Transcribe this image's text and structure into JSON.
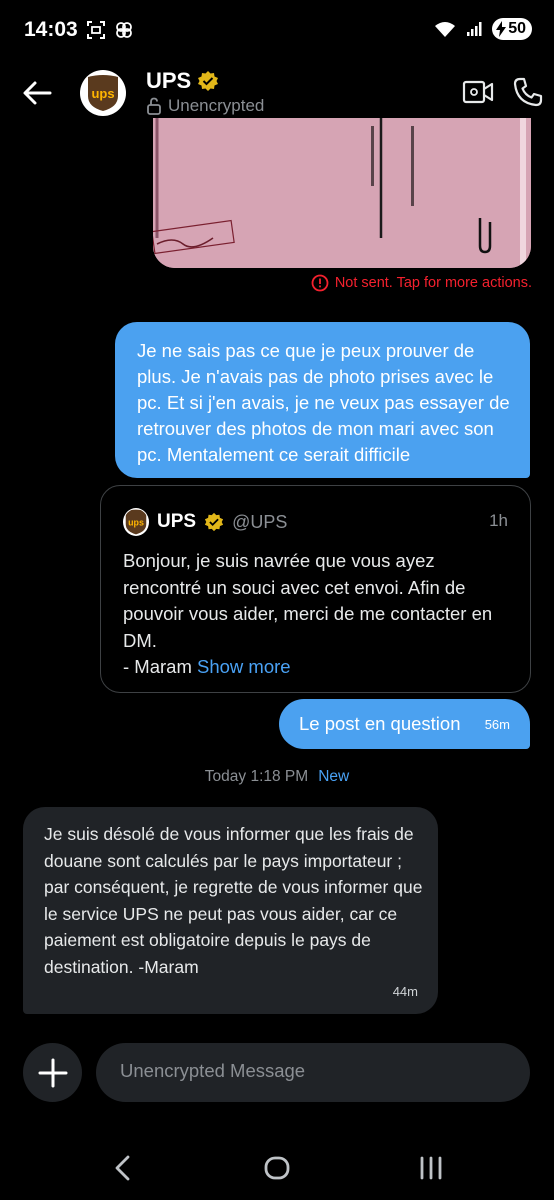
{
  "status_bar": {
    "time": "14:03",
    "battery": "50"
  },
  "header": {
    "name": "UPS",
    "subtitle": "Unencrypted"
  },
  "logo": {
    "text": "ups"
  },
  "image_message": {
    "status_text": "Not sent. Tap for more actions."
  },
  "messages": {
    "outgoing_1": "Je ne sais pas ce que je peux prouver de plus. Je n'avais pas de photo prises avec le pc. Et si j'en avais, je ne veux pas essayer de retrouver des photos de mon mari avec son pc. Mentalement ce serait difficile",
    "outgoing_2": {
      "text": "Le post en question",
      "time": "56m"
    },
    "incoming_1": {
      "text": "Je suis désolé de vous informer que les frais de douane sont calculés par le pays importateur ; par conséquent, je regrette de vous informer que le service UPS ne peut pas vous aider, car ce paiement est obligatoire depuis le pays de destination. -Maram",
      "time": "44m"
    }
  },
  "quoted_post": {
    "name": "UPS",
    "handle": "@UPS",
    "time": "1h",
    "body": "Bonjour, je suis navrée que vous ayez rencontré un souci avec cet envoi. Afin de pouvoir vous aider, merci de me contacter en DM.",
    "signature": "- Maram",
    "show_more": "Show more"
  },
  "divider": {
    "date": "Today 1:18 PM",
    "badge": "New"
  },
  "composer": {
    "placeholder": "Unencrypted Message"
  },
  "colors": {
    "accent": "#4ba1f0",
    "error": "#f4212e",
    "verified": "#e2b719",
    "ups_brown": "#5a3a1e",
    "ups_gold": "#ffb500"
  }
}
